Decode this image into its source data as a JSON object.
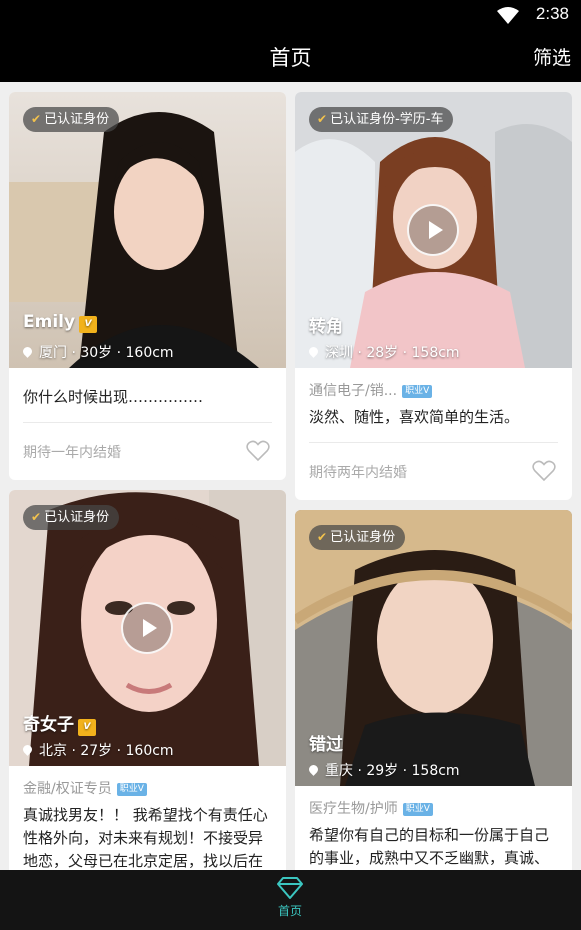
{
  "status": {
    "time": "2:38"
  },
  "header": {
    "title": "首页",
    "filter_label": "筛选"
  },
  "nav": {
    "home_label": "首页"
  },
  "colors": {
    "accent": "#3bc6c0",
    "vip": "#f2b21c",
    "job_tag": "#6ab2e6"
  },
  "cards": [
    {
      "badge": "已认证身份",
      "name": "Emily",
      "vip_icon": "vip-icon",
      "location": "厦门 · 30岁 · 160cm",
      "intro": "你什么时候出现……………",
      "expect": "期待一年内结婚",
      "has_video": false
    },
    {
      "badge": "已认证身份-学历-车",
      "name": "转角",
      "location": "深圳 · 28岁 · 158cm",
      "job": "通信电子/销...",
      "job_tag": "职业V",
      "intro": "淡然、随性，喜欢简单的生活。",
      "expect": "期待两年内结婚",
      "has_video": true
    },
    {
      "badge": "已认证身份",
      "name": "奇女子",
      "vip_icon": "vip-icon",
      "location": "北京 · 27岁 · 160cm",
      "job": "金融/权证专员",
      "job_tag": "职业V",
      "intro": "真诚找男友！！ 我希望找个有责任心性格外向，对未来有规划！不接受异地恋，父母已在北京定居，找以后在北京",
      "has_video": true
    },
    {
      "badge": "已认证身份",
      "name": "错过",
      "location": "重庆 · 29岁 · 158cm",
      "job": "医疗生物/护师",
      "job_tag": "职业V",
      "intro": "希望你有自己的目标和一份属于自己的事业，成熟中又不乏幽默，真诚、坦",
      "has_video": false
    }
  ]
}
